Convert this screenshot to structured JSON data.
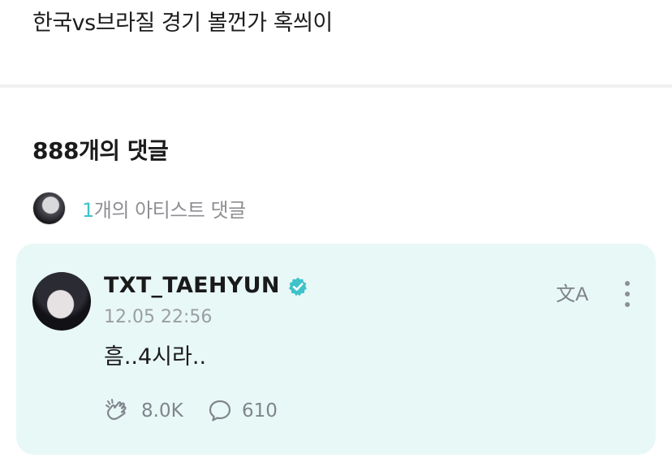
{
  "post": {
    "text": "한국vs브라질 경기 볼껀가 혹씌이"
  },
  "comments_header": {
    "count_label": "888개의 댓글"
  },
  "artist_comments": {
    "count_number": "1",
    "count_suffix": "개의 아티스트 댓글"
  },
  "comment": {
    "username": "TXT_TAEHYUN",
    "verified": true,
    "timestamp": "12.05 22:56",
    "text": "흠..4시라..",
    "likes": "8.0K",
    "replies": "610",
    "translate_icon": "文A"
  },
  "colors": {
    "accent": "#3fc2c9",
    "card_background": "#e8f8f6",
    "verified_badge": "#3fc2c9"
  },
  "icons": {
    "translate": "translate-icon",
    "more": "more-vertical-icon",
    "like": "cheer-hand-icon",
    "reply": "speech-bubble-icon",
    "verified": "verified-badge-icon"
  }
}
